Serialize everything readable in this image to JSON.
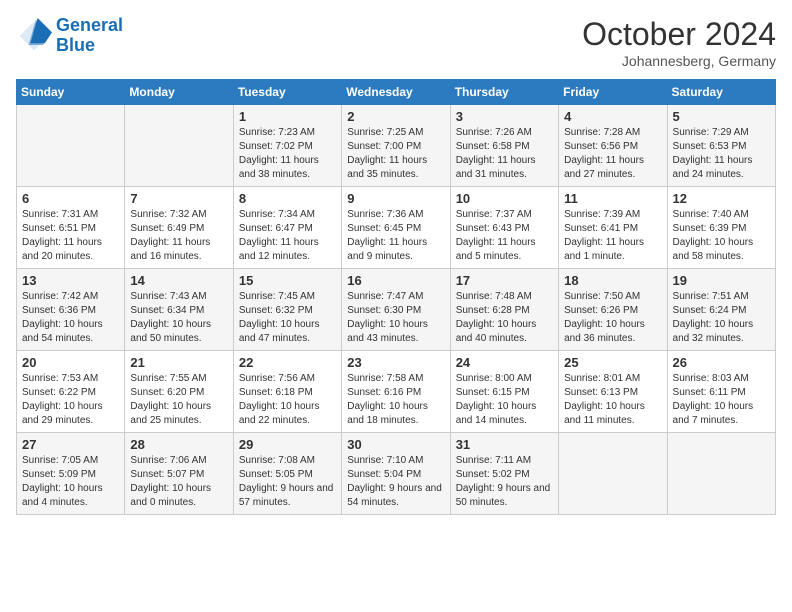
{
  "logo": {
    "line1": "General",
    "line2": "Blue"
  },
  "title": "October 2024",
  "subtitle": "Johannesberg, Germany",
  "headers": [
    "Sunday",
    "Monday",
    "Tuesday",
    "Wednesday",
    "Thursday",
    "Friday",
    "Saturday"
  ],
  "weeks": [
    [
      {
        "day": "",
        "info": ""
      },
      {
        "day": "",
        "info": ""
      },
      {
        "day": "1",
        "info": "Sunrise: 7:23 AM\nSunset: 7:02 PM\nDaylight: 11 hours and 38 minutes."
      },
      {
        "day": "2",
        "info": "Sunrise: 7:25 AM\nSunset: 7:00 PM\nDaylight: 11 hours and 35 minutes."
      },
      {
        "day": "3",
        "info": "Sunrise: 7:26 AM\nSunset: 6:58 PM\nDaylight: 11 hours and 31 minutes."
      },
      {
        "day": "4",
        "info": "Sunrise: 7:28 AM\nSunset: 6:56 PM\nDaylight: 11 hours and 27 minutes."
      },
      {
        "day": "5",
        "info": "Sunrise: 7:29 AM\nSunset: 6:53 PM\nDaylight: 11 hours and 24 minutes."
      }
    ],
    [
      {
        "day": "6",
        "info": "Sunrise: 7:31 AM\nSunset: 6:51 PM\nDaylight: 11 hours and 20 minutes."
      },
      {
        "day": "7",
        "info": "Sunrise: 7:32 AM\nSunset: 6:49 PM\nDaylight: 11 hours and 16 minutes."
      },
      {
        "day": "8",
        "info": "Sunrise: 7:34 AM\nSunset: 6:47 PM\nDaylight: 11 hours and 12 minutes."
      },
      {
        "day": "9",
        "info": "Sunrise: 7:36 AM\nSunset: 6:45 PM\nDaylight: 11 hours and 9 minutes."
      },
      {
        "day": "10",
        "info": "Sunrise: 7:37 AM\nSunset: 6:43 PM\nDaylight: 11 hours and 5 minutes."
      },
      {
        "day": "11",
        "info": "Sunrise: 7:39 AM\nSunset: 6:41 PM\nDaylight: 11 hours and 1 minute."
      },
      {
        "day": "12",
        "info": "Sunrise: 7:40 AM\nSunset: 6:39 PM\nDaylight: 10 hours and 58 minutes."
      }
    ],
    [
      {
        "day": "13",
        "info": "Sunrise: 7:42 AM\nSunset: 6:36 PM\nDaylight: 10 hours and 54 minutes."
      },
      {
        "day": "14",
        "info": "Sunrise: 7:43 AM\nSunset: 6:34 PM\nDaylight: 10 hours and 50 minutes."
      },
      {
        "day": "15",
        "info": "Sunrise: 7:45 AM\nSunset: 6:32 PM\nDaylight: 10 hours and 47 minutes."
      },
      {
        "day": "16",
        "info": "Sunrise: 7:47 AM\nSunset: 6:30 PM\nDaylight: 10 hours and 43 minutes."
      },
      {
        "day": "17",
        "info": "Sunrise: 7:48 AM\nSunset: 6:28 PM\nDaylight: 10 hours and 40 minutes."
      },
      {
        "day": "18",
        "info": "Sunrise: 7:50 AM\nSunset: 6:26 PM\nDaylight: 10 hours and 36 minutes."
      },
      {
        "day": "19",
        "info": "Sunrise: 7:51 AM\nSunset: 6:24 PM\nDaylight: 10 hours and 32 minutes."
      }
    ],
    [
      {
        "day": "20",
        "info": "Sunrise: 7:53 AM\nSunset: 6:22 PM\nDaylight: 10 hours and 29 minutes."
      },
      {
        "day": "21",
        "info": "Sunrise: 7:55 AM\nSunset: 6:20 PM\nDaylight: 10 hours and 25 minutes."
      },
      {
        "day": "22",
        "info": "Sunrise: 7:56 AM\nSunset: 6:18 PM\nDaylight: 10 hours and 22 minutes."
      },
      {
        "day": "23",
        "info": "Sunrise: 7:58 AM\nSunset: 6:16 PM\nDaylight: 10 hours and 18 minutes."
      },
      {
        "day": "24",
        "info": "Sunrise: 8:00 AM\nSunset: 6:15 PM\nDaylight: 10 hours and 14 minutes."
      },
      {
        "day": "25",
        "info": "Sunrise: 8:01 AM\nSunset: 6:13 PM\nDaylight: 10 hours and 11 minutes."
      },
      {
        "day": "26",
        "info": "Sunrise: 8:03 AM\nSunset: 6:11 PM\nDaylight: 10 hours and 7 minutes."
      }
    ],
    [
      {
        "day": "27",
        "info": "Sunrise: 7:05 AM\nSunset: 5:09 PM\nDaylight: 10 hours and 4 minutes."
      },
      {
        "day": "28",
        "info": "Sunrise: 7:06 AM\nSunset: 5:07 PM\nDaylight: 10 hours and 0 minutes."
      },
      {
        "day": "29",
        "info": "Sunrise: 7:08 AM\nSunset: 5:05 PM\nDaylight: 9 hours and 57 minutes."
      },
      {
        "day": "30",
        "info": "Sunrise: 7:10 AM\nSunset: 5:04 PM\nDaylight: 9 hours and 54 minutes."
      },
      {
        "day": "31",
        "info": "Sunrise: 7:11 AM\nSunset: 5:02 PM\nDaylight: 9 hours and 50 minutes."
      },
      {
        "day": "",
        "info": ""
      },
      {
        "day": "",
        "info": ""
      }
    ]
  ]
}
